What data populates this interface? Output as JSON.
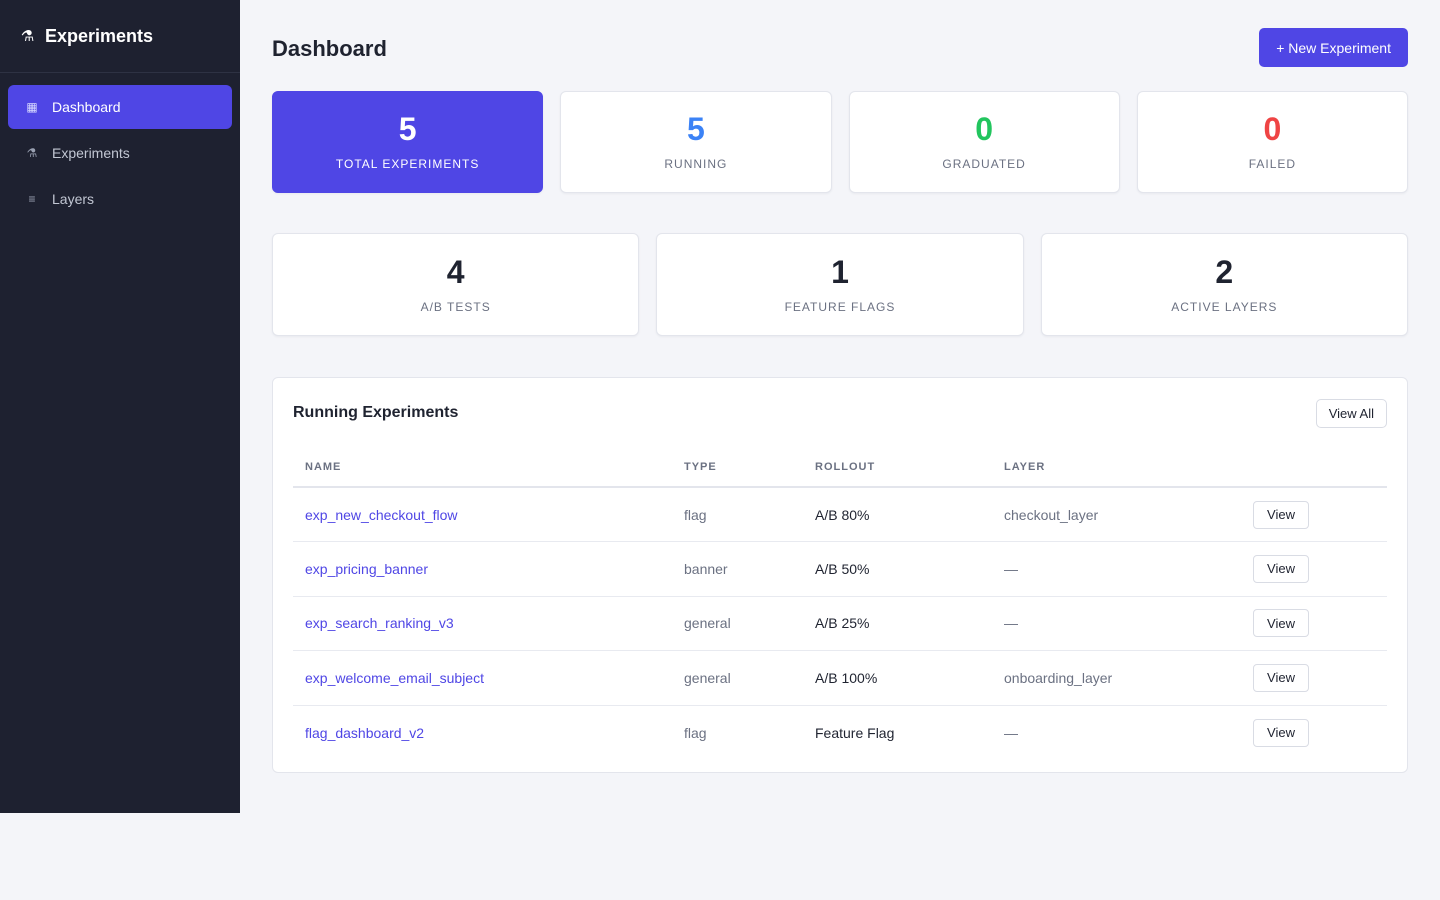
{
  "sidebar": {
    "brand": {
      "icon": "flask-icon",
      "glyph": "⚗",
      "title": "Experiments"
    },
    "items": [
      {
        "label": "Dashboard",
        "icon": "grid-icon",
        "glyph": "▦",
        "active": true
      },
      {
        "label": "Experiments",
        "icon": "flask-icon",
        "glyph": "⚗",
        "active": false
      },
      {
        "label": "Layers",
        "icon": "layers-icon",
        "glyph": "≡",
        "active": false
      }
    ]
  },
  "header": {
    "title": "Dashboard",
    "new_button": "+ New Experiment"
  },
  "stats_primary": [
    {
      "value": "5",
      "label": "TOTAL EXPERIMENTS",
      "color": "#ffffff"
    },
    {
      "value": "5",
      "label": "RUNNING",
      "color": "#3b82f6"
    },
    {
      "value": "0",
      "label": "GRADUATED",
      "color": "#22c55e"
    },
    {
      "value": "0",
      "label": "FAILED",
      "color": "#ef4444"
    }
  ],
  "stats_secondary": [
    {
      "value": "4",
      "label": "A/B TESTS"
    },
    {
      "value": "1",
      "label": "FEATURE FLAGS"
    },
    {
      "value": "2",
      "label": "ACTIVE LAYERS"
    }
  ],
  "running": {
    "title": "Running Experiments",
    "view_all": "View All",
    "columns": [
      "NAME",
      "TYPE",
      "ROLLOUT",
      "LAYER",
      ""
    ],
    "rows": [
      {
        "name": "exp_new_checkout_flow",
        "type": "flag",
        "rollout": "A/B 80%",
        "layer": "checkout_layer",
        "action": "View"
      },
      {
        "name": "exp_pricing_banner",
        "type": "banner",
        "rollout": "A/B 50%",
        "layer": "—",
        "action": "View"
      },
      {
        "name": "exp_search_ranking_v3",
        "type": "general",
        "rollout": "A/B 25%",
        "layer": "—",
        "action": "View"
      },
      {
        "name": "exp_welcome_email_subject",
        "type": "general",
        "rollout": "A/B 100%",
        "layer": "onboarding_layer",
        "action": "View"
      },
      {
        "name": "flag_dashboard_v2",
        "type": "flag",
        "rollout": "Feature Flag",
        "layer": "—",
        "action": "View"
      }
    ]
  },
  "colors": {
    "accent": "#4f46e5",
    "sidebar_bg": "#1e2130",
    "page_bg": "#f4f5f9"
  }
}
